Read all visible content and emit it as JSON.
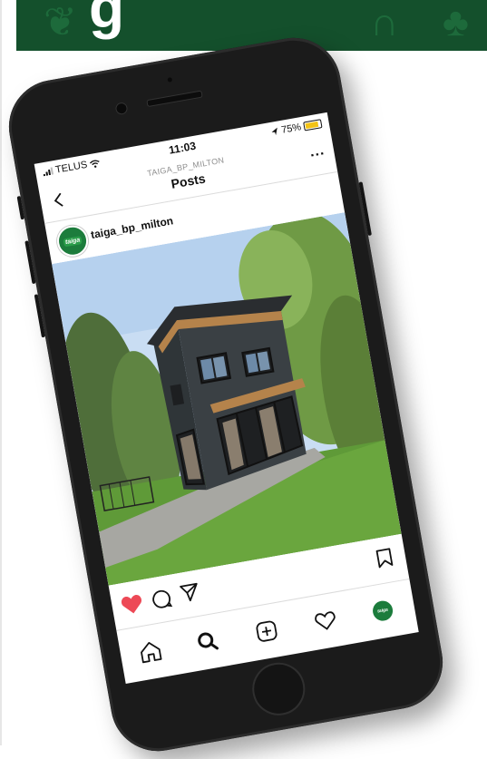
{
  "status_bar": {
    "carrier": "TELUS",
    "time": "11:03",
    "battery_percent": "75%",
    "battery_level": 0.75
  },
  "nav": {
    "subtitle": "TAIGA_BP_MILTON",
    "title": "Posts",
    "more": "..."
  },
  "post": {
    "username": "taiga_bp_milton",
    "avatar_text": "taiga"
  },
  "actions": {
    "like_color": "#ed4956",
    "liked": true
  },
  "colors": {
    "banner": "#14502c",
    "phone_body": "#1b1b1b",
    "accent_green": "#1c7c3c"
  },
  "icons": [
    "heart-icon",
    "comment-icon",
    "share-icon",
    "bookmark-icon",
    "home-icon",
    "search-icon",
    "add-icon",
    "activity-icon",
    "back-icon",
    "more-icon"
  ]
}
